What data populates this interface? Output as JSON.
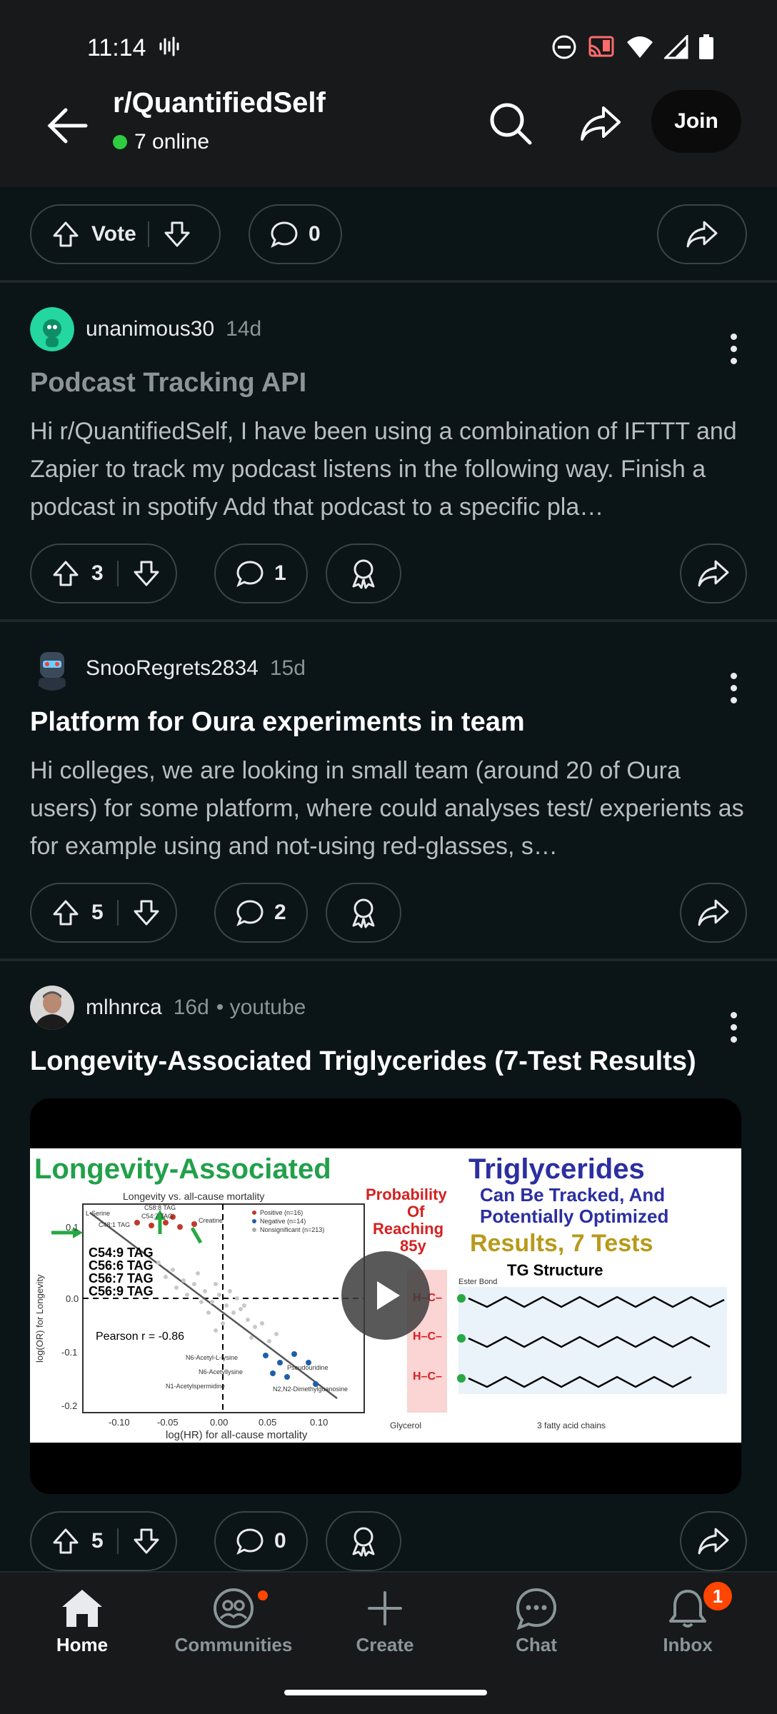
{
  "status_bar": {
    "time": "11:14",
    "icons": [
      "sound-wave-icon",
      "do-not-disturb-icon",
      "cast-icon",
      "wifi-icon",
      "signal-icon",
      "battery-icon"
    ]
  },
  "header": {
    "subreddit": "r/QuantifiedSelf",
    "online": "7 online",
    "join_label": "Join"
  },
  "top_actions": {
    "vote_label": "Vote",
    "comments": "0"
  },
  "posts": [
    {
      "author": "unanimous30",
      "age": "14d",
      "title": "Podcast Tracking API",
      "body": "Hi r/QuantifiedSelf, I have been using a combination of IFTTT and Zapier to track my podcast listens in the following way. Finish a podcast in spotify Add that podcast to a specific pla…",
      "votes": "3",
      "comments": "1"
    },
    {
      "author": "SnooRegrets2834",
      "age": "15d",
      "title": "Platform for Oura experiments in team",
      "body": "Hi colleges, we are looking in small team (around 20 of Oura users) for some platform, where could analyses test/ experients as for example using and not-using red-glasses, s…",
      "votes": "5",
      "comments": "2"
    },
    {
      "author": "mlhnrca",
      "age": "16d",
      "source": "• youtube",
      "title": "Longevity-Associated Triglycerides (7-Test Results)",
      "votes": "5",
      "comments": "0",
      "thumbnail": {
        "heading_green": "Longevity-Associated",
        "heading_blue": "Triglycerides",
        "prob_text": "Probability",
        "prob_of": "Of",
        "prob_reaching": "Reaching",
        "prob_age": "85y",
        "tracked_line1": "Can Be Tracked, And",
        "tracked_line2": "Potentially Optimized",
        "results": "Results, 7 Tests",
        "tg_structure": "TG Structure",
        "plot_title": "Longevity vs. all-cause mortality",
        "tags": [
          "C54:9 TAG",
          "C56:6 TAG",
          "C56:7 TAG",
          "C56:9 TAG"
        ],
        "pearson": "Pearson r = -0.86",
        "xlabel": "log(HR) for all-cause mortality",
        "ylabel": "log(OR) for Longevity",
        "xticks": [
          "-0.10",
          "-0.05",
          "0.00",
          "0.05",
          "0.10"
        ],
        "yticks": [
          "0.1",
          "0.0",
          "-0.1",
          "-0.2"
        ],
        "glycerol": "Glycerol",
        "fatty": "3 fatty acid chains",
        "ester": "Ester Bond",
        "legend": [
          "Positive (n=16)",
          "Negative (n=14)",
          "Nonsignificant (n=213)"
        ],
        "labels": [
          "L-Serine",
          "C48:1 TAG",
          "C58:8 TAG",
          "C54:7 TAG",
          "Creatine",
          "N6-Acetyl-L-lysine",
          "N6-Acetyllysine",
          "N1-Acetylspermidine",
          "Pseudouridine",
          "N2,N2-Dimethylguanosine"
        ]
      }
    }
  ],
  "bottom_nav": [
    {
      "label": "Home",
      "icon": "home-icon",
      "active": true
    },
    {
      "label": "Communities",
      "icon": "communities-icon"
    },
    {
      "label": "Create",
      "icon": "plus-icon"
    },
    {
      "label": "Chat",
      "icon": "chat-icon"
    },
    {
      "label": "Inbox",
      "icon": "bell-icon",
      "badge": "1"
    }
  ],
  "colors": {
    "background": "#0b1416",
    "bar": "#17191b",
    "accent": "#ff4500",
    "online": "#2ecc40"
  }
}
